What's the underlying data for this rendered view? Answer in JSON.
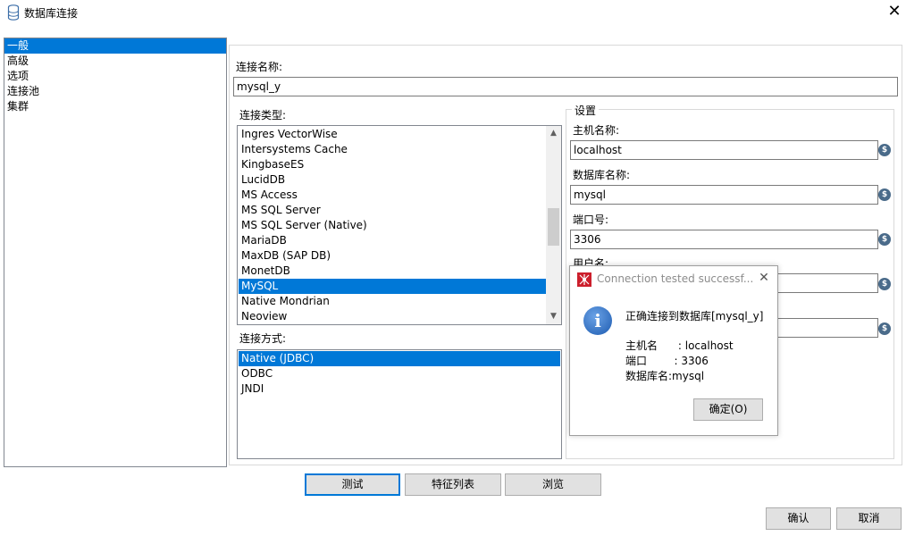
{
  "window": {
    "title": "数据库连接",
    "close_glyph": "✕"
  },
  "nav": {
    "items": [
      "一般",
      "高级",
      "选项",
      "连接池",
      "集群"
    ],
    "selected_index": 0
  },
  "form": {
    "conn_name_label": "连接名称:",
    "conn_name_value": "mysql_y",
    "conn_type_label": "连接类型:",
    "conn_types": [
      "Ingres VectorWise",
      "Intersystems Cache",
      "KingbaseES",
      "LucidDB",
      "MS Access",
      "MS SQL Server",
      "MS SQL Server (Native)",
      "MariaDB",
      "MaxDB (SAP DB)",
      "MonetDB",
      "MySQL",
      "Native Mondrian",
      "Neoview"
    ],
    "conn_type_selected": "MySQL",
    "access_label": "连接方式:",
    "access_methods": [
      "Native (JDBC)",
      "ODBC",
      "JNDI"
    ],
    "access_selected": "Native (JDBC)"
  },
  "settings": {
    "group_label": "设置",
    "host_label": "主机名称:",
    "host_value": "localhost",
    "db_label": "数据库名称:",
    "db_value": "mysql",
    "port_label": "端口号:",
    "port_value": "3306",
    "user_label": "用户名:",
    "var_icon_glyph": "$"
  },
  "buttons": {
    "test": "测试",
    "features": "特征列表",
    "explore": "浏览",
    "ok": "确认",
    "cancel": "取消"
  },
  "dialog": {
    "title": "Connection tested successf...",
    "message": "正确连接到数据库[mysql_y]",
    "host_line": "主机名      : localhost",
    "port_line": "端口        : 3306",
    "db_line": "数据库名:mysql",
    "ok_label": "确定(O)",
    "info_glyph": "i",
    "close_glyph": "✕"
  },
  "colors": {
    "selection": "#0078d7",
    "button_bg": "#e1e1e1",
    "dialog_icon": "#cc1f2c"
  }
}
